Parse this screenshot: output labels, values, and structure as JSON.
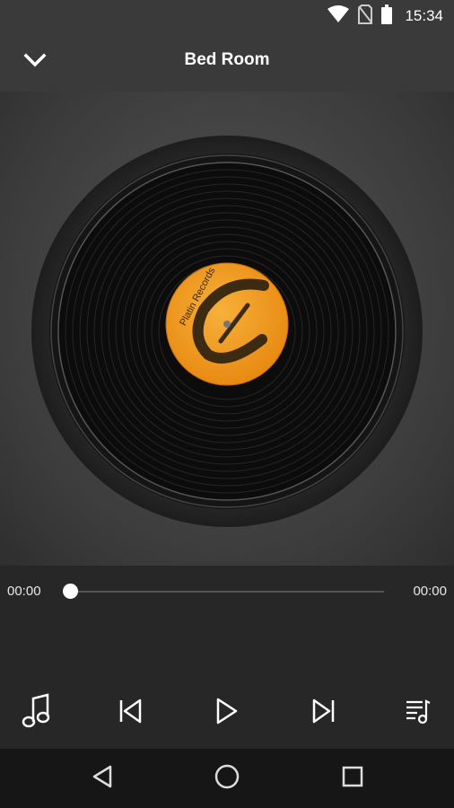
{
  "status_bar": {
    "time": "15:34",
    "icons": [
      "wifi-icon",
      "no-sim-icon",
      "battery-icon"
    ]
  },
  "toolbar": {
    "title": "Bed Room",
    "back_icon": "chevron-down-icon"
  },
  "album_art": {
    "label_text": "Platin Records",
    "label_color": "#f29a1a"
  },
  "player": {
    "current_time": "00:00",
    "total_time": "00:00",
    "progress": 0
  },
  "controls": [
    "music-note-icon",
    "previous-icon",
    "play-icon",
    "next-icon",
    "playlist-icon"
  ],
  "nav_bar": [
    "back-triangle-icon",
    "home-circle-icon",
    "recents-square-icon"
  ]
}
